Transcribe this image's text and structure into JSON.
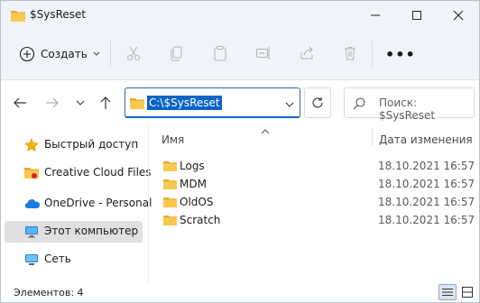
{
  "window": {
    "title": "$SysReset"
  },
  "toolbar": {
    "create_label": "Создать",
    "icons": [
      "cut-icon",
      "copy-icon",
      "paste-icon",
      "rename-icon",
      "share-icon",
      "delete-icon"
    ],
    "more_label": "•••"
  },
  "address": {
    "path": "C:\\$SysReset"
  },
  "search": {
    "placeholder": "Поиск: $SysReset"
  },
  "sidebar": {
    "items": [
      {
        "label": "Быстрый доступ",
        "icon": "star-icon",
        "selected": false
      },
      {
        "label": "Creative Cloud Files",
        "icon": "creative-cloud-icon",
        "selected": false
      },
      {
        "label": "OneDrive - Personal",
        "icon": "cloud-icon",
        "selected": false
      },
      {
        "label": "Этот компьютер",
        "icon": "computer-icon",
        "selected": true
      },
      {
        "label": "Сеть",
        "icon": "network-icon",
        "selected": false
      }
    ]
  },
  "list": {
    "headers": {
      "name": "Имя",
      "date": "Дата изменения"
    },
    "rows": [
      {
        "name": "Logs",
        "date": "18.10.2021 16:57"
      },
      {
        "name": "MDM",
        "date": "18.10.2021 16:57"
      },
      {
        "name": "OldOS",
        "date": "18.10.2021 16:57"
      },
      {
        "name": "Scratch",
        "date": "18.10.2021 16:57"
      }
    ]
  },
  "status": {
    "count_label": "Элементов: 4"
  },
  "colors": {
    "accent": "#0a64c8",
    "folder": "#f4c24d",
    "titlebar": "#f0f3f9"
  }
}
